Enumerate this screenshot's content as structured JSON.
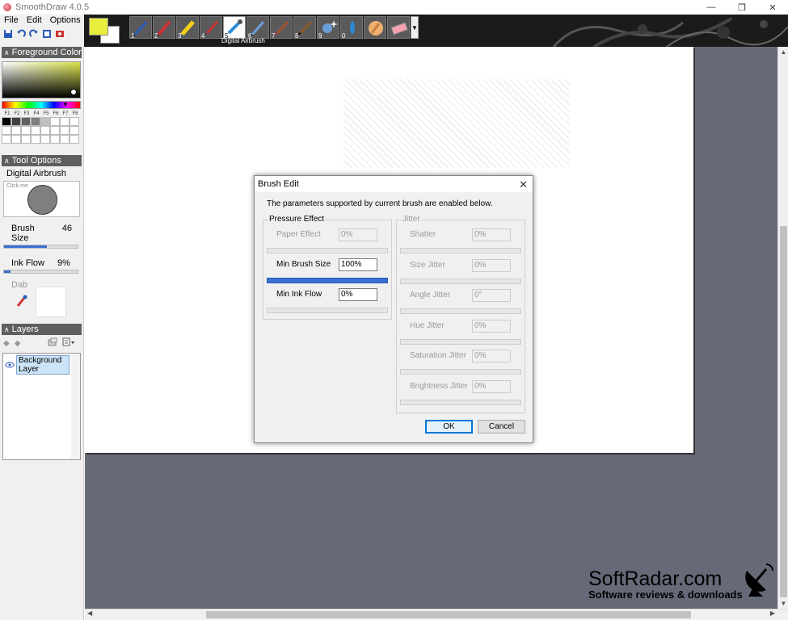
{
  "window": {
    "title": "SmoothDraw 4.0.5",
    "minimize": "—",
    "restore": "❐",
    "close": "✕"
  },
  "menu": {
    "items": [
      "File",
      "Edit",
      "Options"
    ]
  },
  "tools": {
    "items": [
      {
        "num": "1",
        "icon": "pen-icon"
      },
      {
        "num": "2",
        "icon": "pencil-icon"
      },
      {
        "num": "3",
        "icon": "highlighter-icon"
      },
      {
        "num": "4",
        "icon": "brush-icon"
      },
      {
        "num": "5",
        "icon": "airbrush-icon"
      },
      {
        "num": "6",
        "icon": "digital-pen-icon"
      },
      {
        "num": "7",
        "icon": "wet-brush-icon"
      },
      {
        "num": "8",
        "icon": "flat-brush-icon"
      },
      {
        "num": "9",
        "icon": "sparkle-icon"
      },
      {
        "num": "0",
        "icon": "water-drop-icon"
      },
      {
        "num": "",
        "icon": "smudge-hand-icon"
      },
      {
        "num": "",
        "icon": "eraser-icon"
      }
    ],
    "selected_index": 4,
    "selected_caption": "Digital Airbrush"
  },
  "colors": {
    "foreground": "#e8ee3c",
    "background": "#ffffff"
  },
  "panels": {
    "foreground": {
      "title": "Foreground Color",
      "fkeys": [
        "F1",
        "F2",
        "F3",
        "F4",
        "F5",
        "F6",
        "F7",
        "F8"
      ],
      "swatches": [
        "#000000",
        "#404040",
        "#606060",
        "#808080",
        "#c0c0c0",
        "#ffffff",
        "#ffffff",
        "#ffffff"
      ]
    },
    "tool_options": {
      "title": "Tool Options",
      "tool_name": "Digital Airbrush",
      "click_me": "Click me",
      "brush_size_label": "Brush Size",
      "brush_size_value": "46",
      "brush_size_fraction": 0.58,
      "ink_flow_label": "Ink Flow",
      "ink_flow_value": "9%",
      "ink_flow_fraction": 0.09,
      "dab_label": "Dab"
    },
    "layers": {
      "title": "Layers",
      "items": [
        "Background Layer"
      ]
    }
  },
  "dialog": {
    "title": "Brush Edit",
    "close": "✕",
    "note": "The parameters supported by current brush are enabled below.",
    "pressure": {
      "title": "Pressure Effect",
      "rows": [
        {
          "label": "Paper Effect",
          "value": "0%",
          "enabled": false
        },
        {
          "label": "Min Brush Size",
          "value": "100%",
          "enabled": true
        },
        {
          "label": "Min Ink Flow",
          "value": "0%",
          "enabled": true
        }
      ]
    },
    "jitter": {
      "title": "Jitter",
      "rows": [
        {
          "label": "Shatter",
          "value": "0%"
        },
        {
          "label": "Size Jitter",
          "value": "0%"
        },
        {
          "label": "Angle Jitter",
          "value": "0°"
        },
        {
          "label": "Hue Jitter",
          "value": "0%"
        },
        {
          "label": "Saturation Jitter",
          "value": "0%"
        },
        {
          "label": "Brightness Jitter",
          "value": "0%"
        }
      ]
    },
    "ok_label": "OK",
    "cancel_label": "Cancel"
  },
  "watermark": {
    "brand": "SoftRadar.com",
    "tagline": "Software reviews & downloads"
  }
}
